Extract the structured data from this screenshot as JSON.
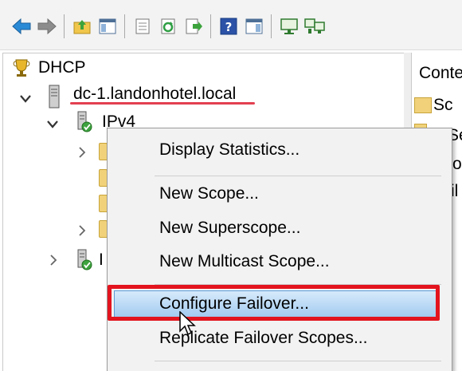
{
  "toolbar": {
    "icons": [
      "back-arrow-icon",
      "forward-arrow-icon",
      "up-folder-icon",
      "show-hide-tree-icon",
      "properties-icon",
      "refresh-icon",
      "export-list-icon",
      "help-icon",
      "action-pane-icon",
      "add-server-icon",
      "network-icon"
    ]
  },
  "tree": {
    "root_label": "DHCP",
    "server_label": "dc-1.landonhotel.local",
    "ipv4_label": "IPv4",
    "ipv6_partial": "I"
  },
  "context_menu": {
    "items": [
      "Display Statistics...",
      "New Scope...",
      "New Superscope...",
      "New Multicast Scope...",
      "Configure Failover...",
      "Replicate Failover Scopes..."
    ],
    "highlighted": "Configure Failover..."
  },
  "right_pane": {
    "header_partial": "Conte",
    "row1_partial": "Sc",
    "row2_partial": "Se",
    "row3_partial": "o",
    "row4_partial": "il"
  },
  "colors": {
    "underline_red": "#e34050",
    "highlight_box_red": "#e3141e",
    "selection_blue": "#9cc7ee"
  }
}
